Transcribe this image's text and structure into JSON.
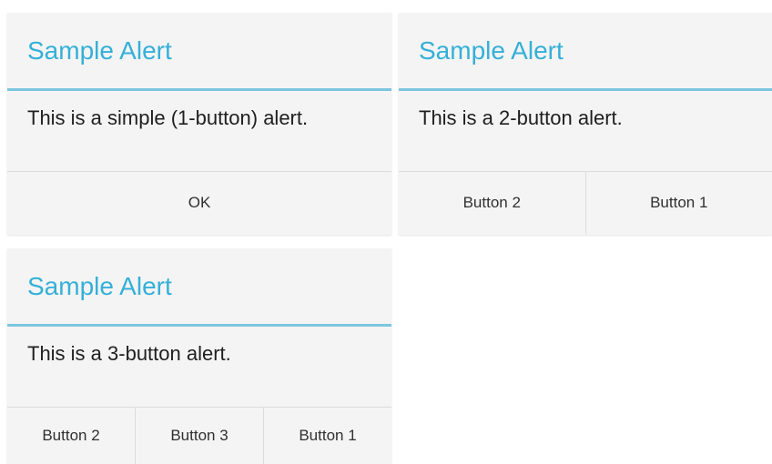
{
  "dialogs": [
    {
      "title": "Sample Alert",
      "message": "This is a simple (1-button) alert.",
      "buttons": [
        "OK"
      ]
    },
    {
      "title": "Sample Alert",
      "message": "This is a 2-button alert.",
      "buttons": [
        "Button 2",
        "Button 1"
      ]
    },
    {
      "title": "Sample Alert",
      "message": "This is a 3-button alert.",
      "buttons": [
        "Button 2",
        "Button 3",
        "Button 1"
      ]
    }
  ],
  "colors": {
    "title": "#35b0d8",
    "divider": "#7cc6de",
    "dialog_background": "#f4f4f4"
  }
}
